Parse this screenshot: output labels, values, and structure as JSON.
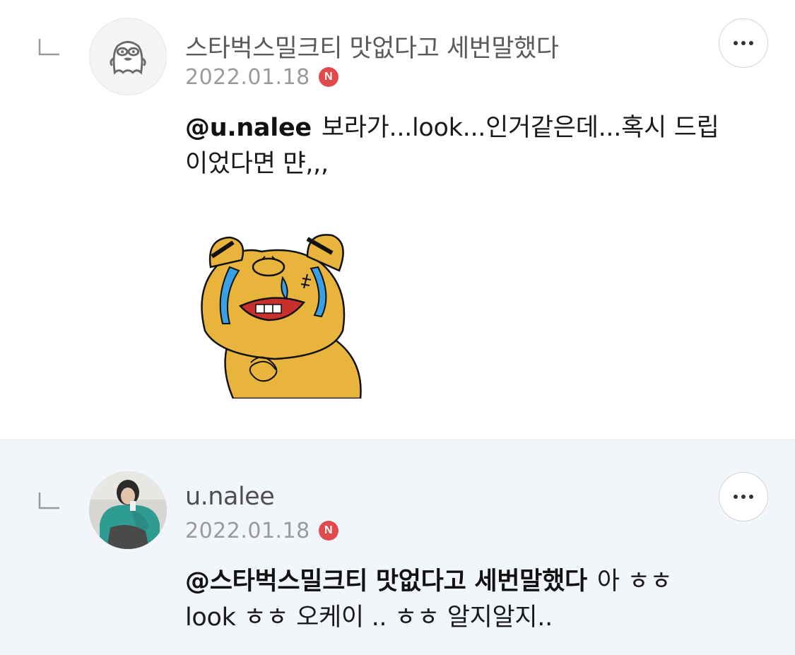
{
  "comments": [
    {
      "username": "스타벅스밀크티 맛없다고 세번말했다",
      "date": "2022.01.18",
      "badge": "N",
      "mention": "@u.nalee",
      "text": "보라가...look...인거같은데...혹시 드립이었다면 먄,,,",
      "avatar_icon": "character-avatar-icon",
      "sticker_icon": "crying-bear-sticker"
    },
    {
      "username": "u.nalee",
      "date": "2022.01.18",
      "badge": "N",
      "mention": "@스타벅스밀크티 맛없다고 세번말했다",
      "text": "아 ㅎㅎ look ㅎㅎ 오케이 .. ㅎㅎ 알지알지..",
      "avatar_icon": "profile-photo-avatar"
    }
  ],
  "colors": {
    "badge": "#df4a4a",
    "highlight_bg": "#f2f6fb",
    "bear": "#e8b43c",
    "tears": "#3aa0e6"
  }
}
